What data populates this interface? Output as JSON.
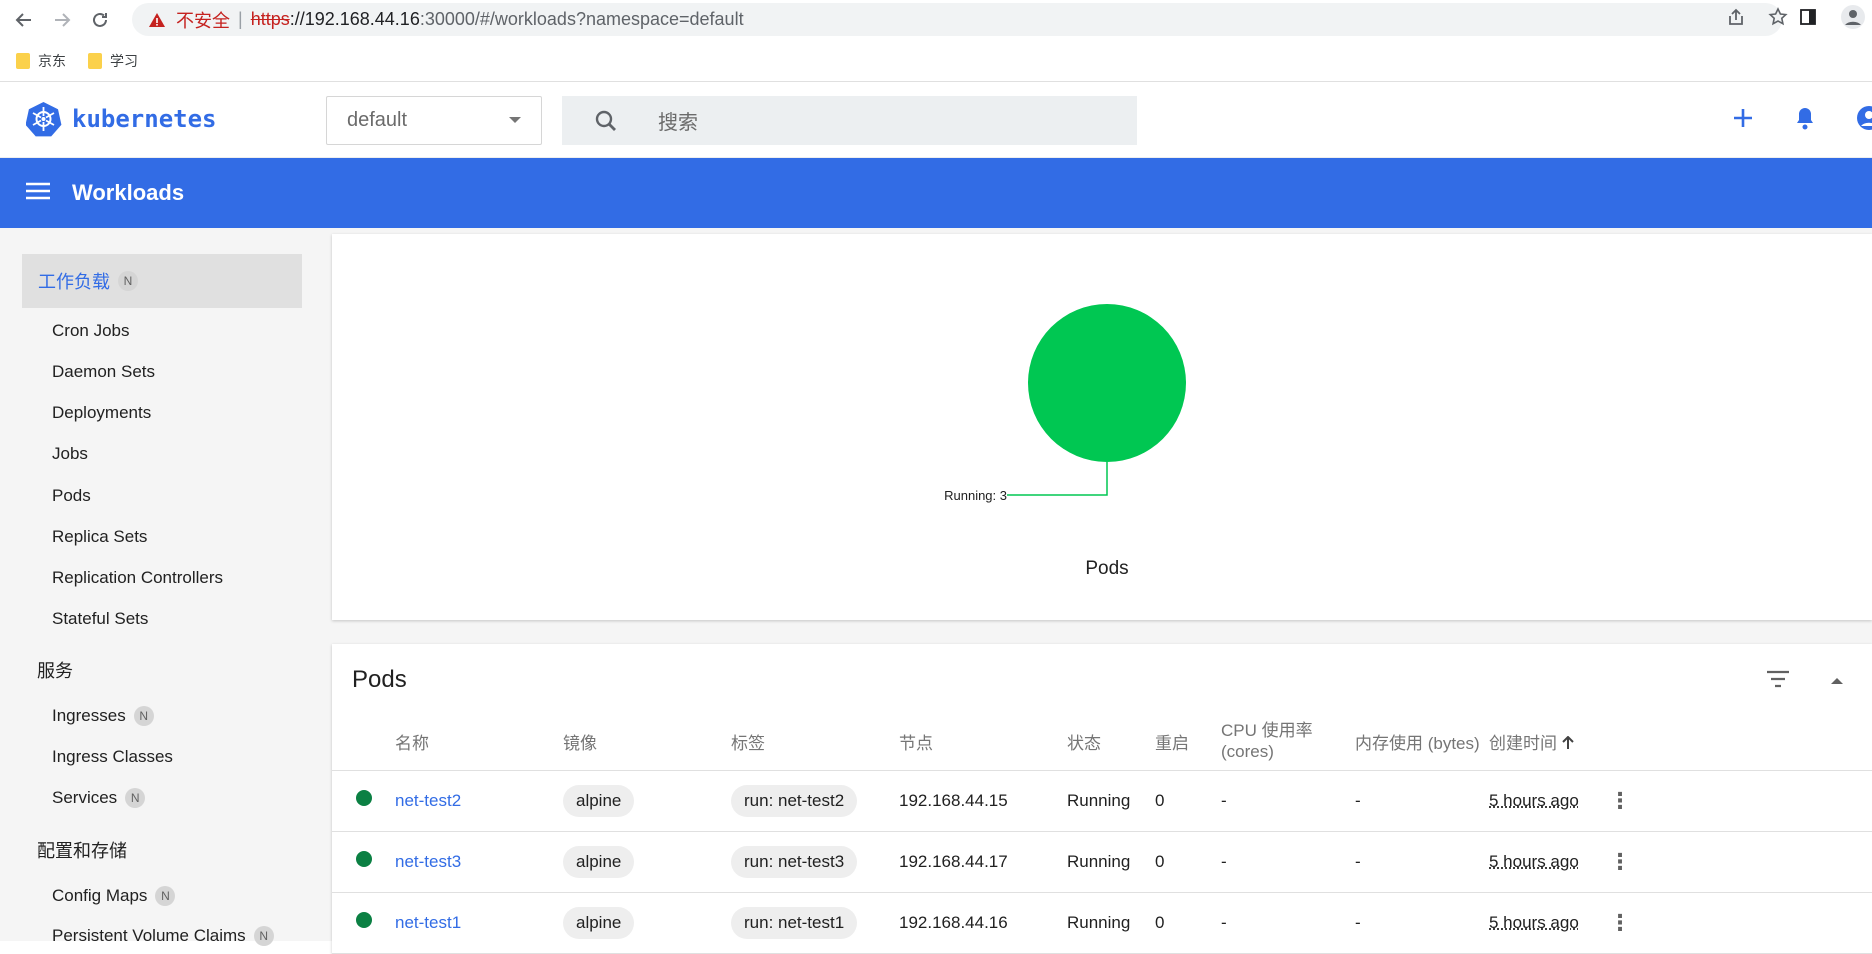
{
  "browser": {
    "not_secure": "不安全",
    "separator": "|",
    "url_scheme": "https",
    "url_host": "://192.168.44.16",
    "url_rest": ":30000/#/workloads?namespace=default",
    "bookmarks": [
      {
        "label": "京东"
      },
      {
        "label": "学习"
      }
    ]
  },
  "header": {
    "logo_text": "kubernetes",
    "namespace": "default",
    "search_placeholder": "搜索"
  },
  "toolbar": {
    "title": "Workloads"
  },
  "sidebar": {
    "workloads_section": "工作负载",
    "ns_badge": "N",
    "workload_items": [
      "Cron Jobs",
      "Daemon Sets",
      "Deployments",
      "Jobs",
      "Pods",
      "Replica Sets",
      "Replication Controllers",
      "Stateful Sets"
    ],
    "services_section": "服务",
    "service_items": [
      {
        "label": "Ingresses",
        "badge": "N"
      },
      {
        "label": "Ingress Classes",
        "badge": ""
      },
      {
        "label": "Services",
        "badge": "N"
      }
    ],
    "config_section": "配置和存储",
    "config_items": [
      {
        "label": "Config Maps",
        "badge": "N"
      },
      {
        "label": "Persistent Volume Claims",
        "badge": "N"
      }
    ]
  },
  "chart": {
    "running_label": "Running: 3",
    "title": "Pods"
  },
  "chart_data": {
    "type": "pie",
    "categories": [
      "Running"
    ],
    "values": [
      3
    ],
    "title": "Pods",
    "colors": [
      "#00c752"
    ]
  },
  "pods": {
    "title": "Pods",
    "columns": [
      "名称",
      "镜像",
      "标签",
      "节点",
      "状态",
      "重启",
      "CPU 使用率",
      "(cores)",
      "内存使用 (bytes)",
      "创建时间"
    ],
    "rows": [
      {
        "name": "net-test2",
        "image": "alpine",
        "label": "run: net-test2",
        "node": "192.168.44.15",
        "status": "Running",
        "restarts": "0",
        "cpu": "-",
        "memory": "-",
        "created": "5 hours ago"
      },
      {
        "name": "net-test3",
        "image": "alpine",
        "label": "run: net-test3",
        "node": "192.168.44.17",
        "status": "Running",
        "restarts": "0",
        "cpu": "-",
        "memory": "-",
        "created": "5 hours ago"
      },
      {
        "name": "net-test1",
        "image": "alpine",
        "label": "run: net-test1",
        "node": "192.168.44.16",
        "status": "Running",
        "restarts": "0",
        "cpu": "-",
        "memory": "-",
        "created": "5 hours ago"
      }
    ]
  },
  "colors": {
    "brand": "#326ce5",
    "running": "#0b8043",
    "chart_fill": "#00c752"
  }
}
